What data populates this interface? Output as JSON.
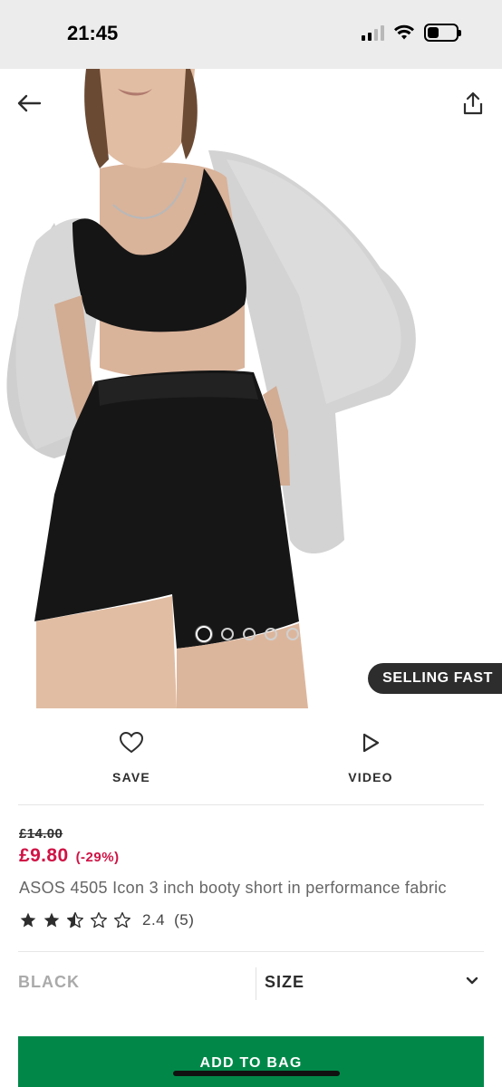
{
  "status_bar": {
    "time": "21:45",
    "icons": [
      "cellular-signal-icon",
      "wifi-icon",
      "battery-icon"
    ]
  },
  "header": {
    "back_icon": "arrow-left-icon",
    "share_icon": "share-icon"
  },
  "gallery": {
    "image": "model wearing black sports bra, black shorts and grey hoodie",
    "dots_count": 5,
    "active_dot": 1,
    "badge": "SELLING FAST"
  },
  "actions": {
    "save_label": "SAVE",
    "video_label": "VIDEO"
  },
  "price": {
    "was": "£14.00",
    "now": "£9.80",
    "discount": "(-29%)"
  },
  "product": {
    "title": "ASOS 4505 Icon 3 inch booty short in performance fabric"
  },
  "rating": {
    "value": "2.4",
    "count": "(5)",
    "stars": 2.5
  },
  "variants": {
    "colour": "BLACK",
    "size_label": "SIZE"
  },
  "cta": {
    "add_to_bag": "ADD TO BAG"
  },
  "colors": {
    "sale_red": "#d01345",
    "cta_green": "#018849",
    "badge_bg": "#2d2d2d"
  }
}
